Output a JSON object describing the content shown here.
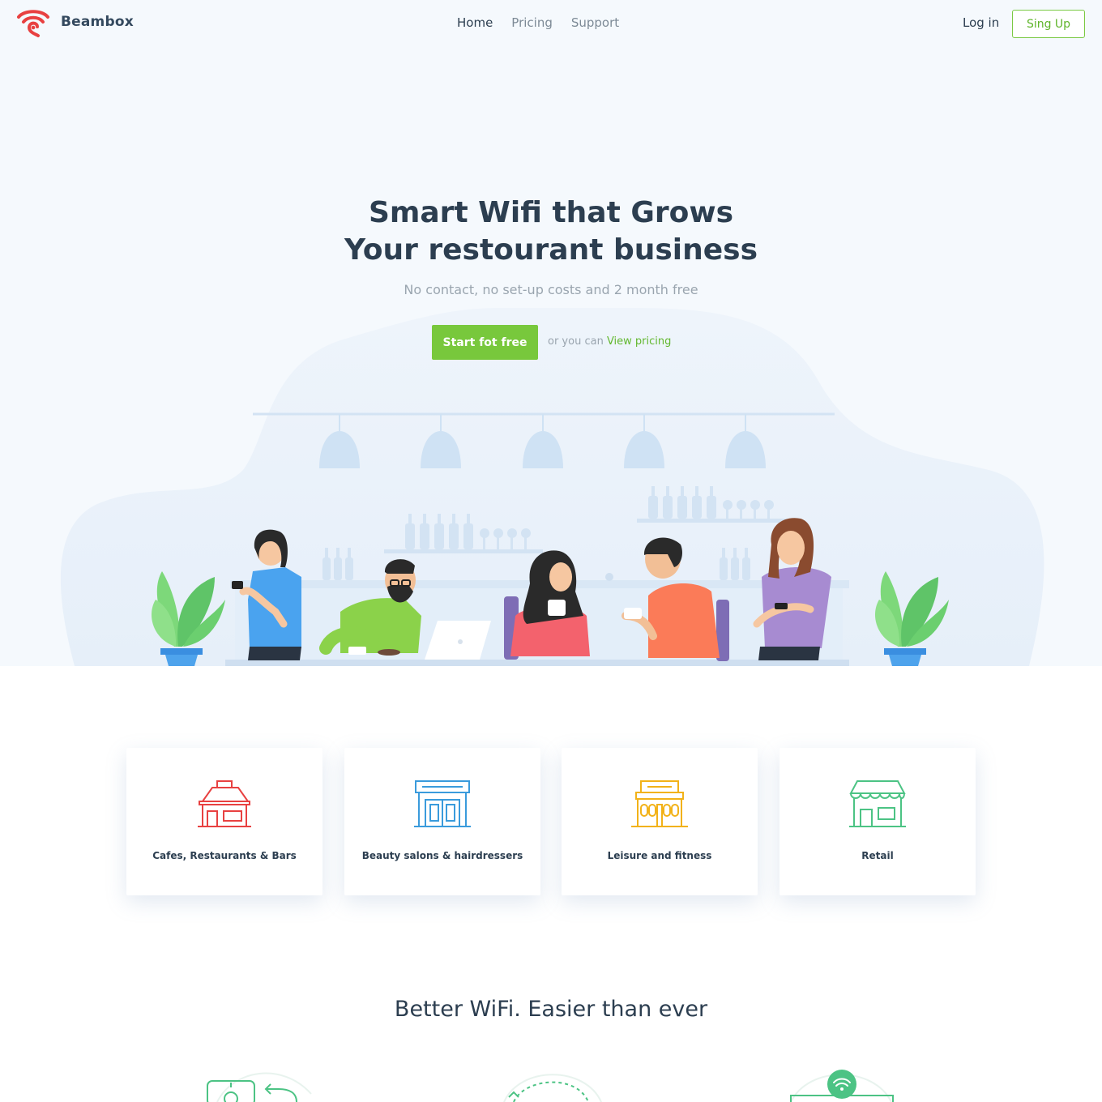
{
  "brand": {
    "name": "Beambox",
    "logo_icon": "wifi-logo-icon",
    "logo_color": "#e84141"
  },
  "nav": {
    "links": [
      {
        "label": "Home",
        "active": true
      },
      {
        "label": "Pricing",
        "active": false
      },
      {
        "label": "Support",
        "active": false
      }
    ],
    "login_label": "Log in",
    "signup_label": "Sing Up"
  },
  "hero": {
    "headline_line1": "Smart Wifi that Grows",
    "headline_line2": "Your restourant business",
    "subline": "No contact, no set-up costs and 2 month free",
    "cta_label": "Start fot free",
    "alt_prefix": "or you can",
    "alt_link": "View pricing",
    "accent_color": "#78c83c"
  },
  "categories": [
    {
      "label": "Cafes, Restaurants & Bars",
      "icon": "cafe-building-icon",
      "color": "#e84141"
    },
    {
      "label": "Beauty salons & hairdressers",
      "icon": "salon-storefront-icon",
      "color": "#3a9bdc"
    },
    {
      "label": "Leisure and fitness",
      "icon": "leisure-building-icon",
      "color": "#f2b218"
    },
    {
      "label": "Retail",
      "icon": "retail-store-icon",
      "color": "#4cc384"
    }
  ],
  "features": {
    "title": "Better WiFi. Easier than ever",
    "icons": [
      "device-return-icon",
      "dashed-circle-arrow-icon",
      "wifi-router-icon"
    ]
  }
}
